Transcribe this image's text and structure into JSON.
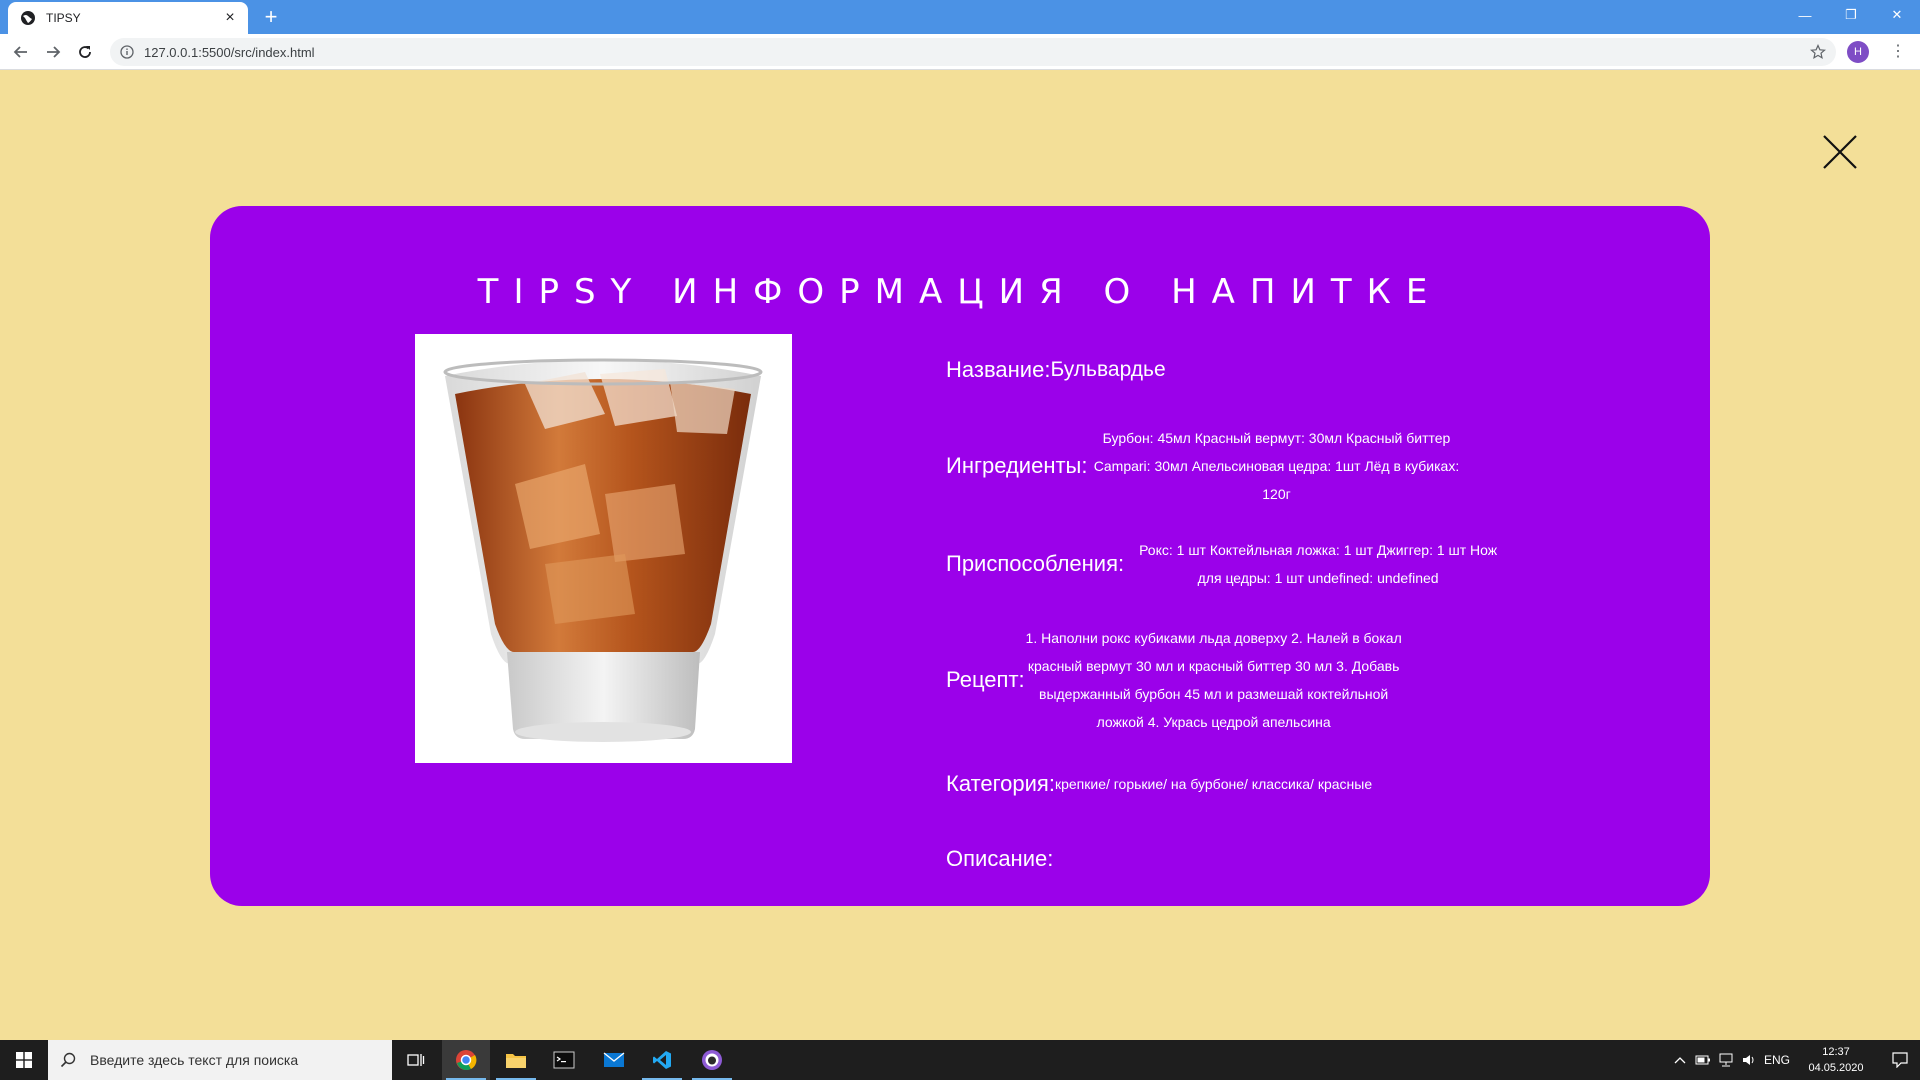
{
  "browser": {
    "tab_title": "TIPSY",
    "tab_close": "×",
    "new_tab": "+",
    "url": "127.0.0.1:5500/src/index.html",
    "profile_initial": "H",
    "menu": "⋮",
    "window_controls": {
      "minimize": "—",
      "restore": "❐",
      "close": "✕"
    }
  },
  "modal": {
    "title": "TIPSY ИНФОРМАЦИЯ О НАПИТКЕ",
    "name_label": "Название:",
    "name_value": "Бульвардье",
    "ingredients_label": "Ингредиенты:",
    "ingredients_value": "Бурбон: 45мл Красный вермут: 30мл Красный биттер Campari: 30мл Апельсиновая цедра: 1шт Лёд в кубиках: 120г",
    "tools_label": "Приспособления:",
    "tools_value": "Рокс: 1 шт Коктейльная ложка: 1 шт Джиггер: 1 шт Нож для цедры: 1 шт undefined: undefined",
    "recipe_label": "Рецепт:",
    "recipe_value": "1. Наполни рокс кубиками льда доверху 2. Налей в бокал красный вермут 30 мл и красный биттер 30 мл 3. Добавь выдержанный бурбон 45 мл и размешай коктейльной ложкой 4. Укрась цедрой апельсина",
    "category_label": "Категория:",
    "category_value": "крепкие/ горькие/ на бурбоне/ классика/ красные",
    "description_label": "Описание:"
  },
  "taskbar": {
    "search_placeholder": "Введите здесь текст для поиска",
    "language": "ENG",
    "time": "12:37",
    "date": "04.05.2020"
  },
  "colors": {
    "page_background": "#f3df98",
    "modal_background": "#9b01ea",
    "browser_tabbar": "#4b92e5"
  }
}
